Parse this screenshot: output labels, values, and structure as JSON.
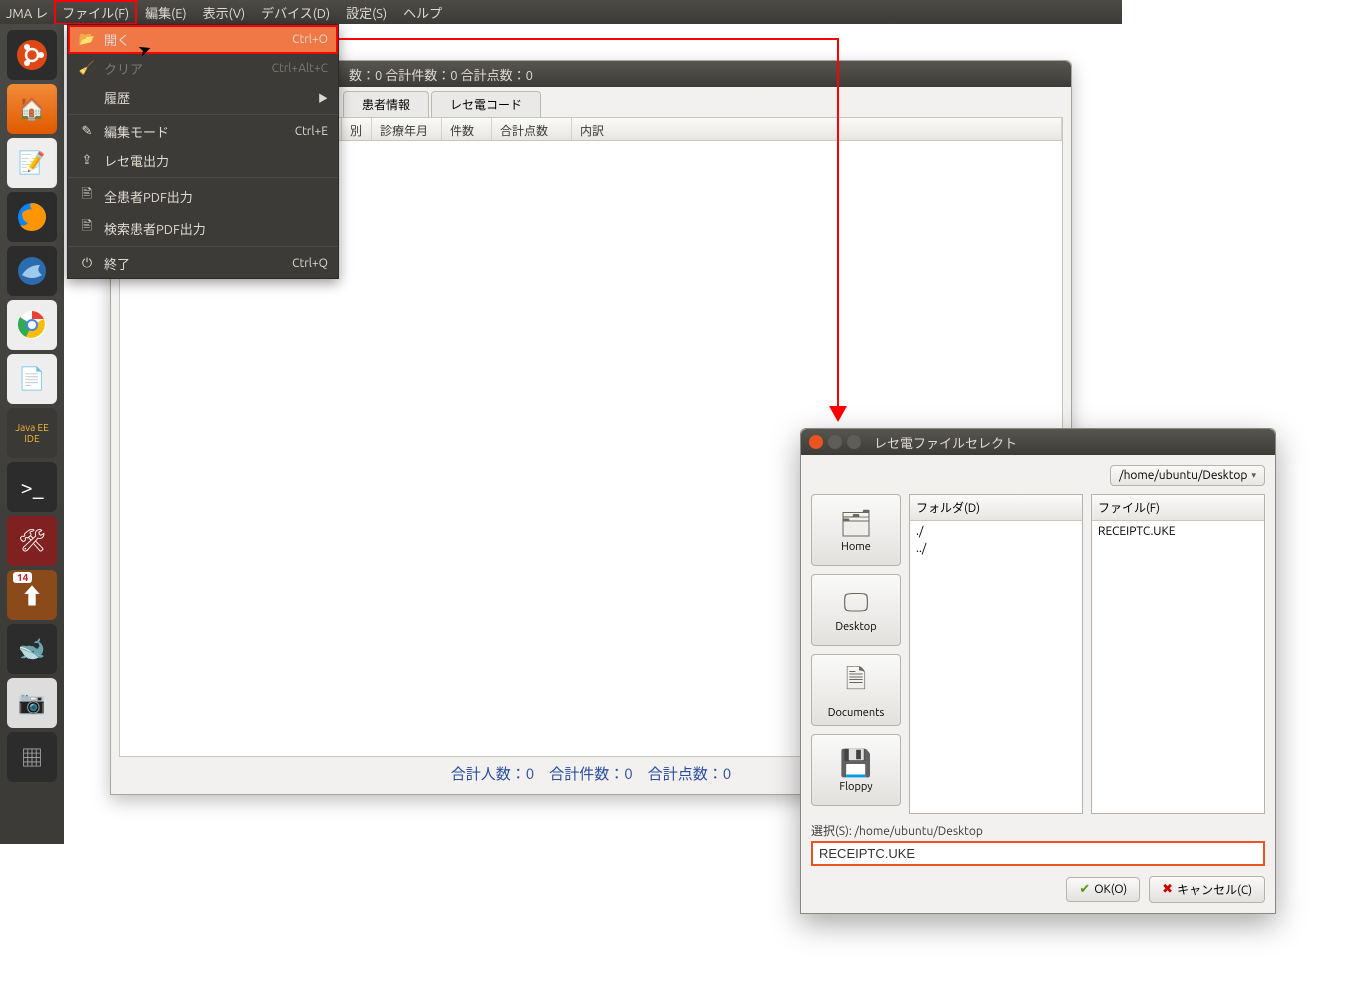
{
  "menubar": {
    "app_prefix": "JMA レ",
    "items": [
      "ファイル(F)",
      "編集(E)",
      "表示(V)",
      "デバイス(D)",
      "設定(S)",
      "ヘルプ"
    ]
  },
  "dropdown": {
    "open": {
      "label": "開く",
      "shortcut": "Ctrl+O"
    },
    "clear": {
      "label": "クリア",
      "shortcut": "Ctrl+Alt+C"
    },
    "history": {
      "label": "履歴"
    },
    "editmode": {
      "label": "編集モード",
      "shortcut": "Ctrl+E"
    },
    "receden": {
      "label": "レセ電出力"
    },
    "allpdf": {
      "label": "全患者PDF出力"
    },
    "searchpdf": {
      "label": "検索患者PDF出力"
    },
    "quit": {
      "label": "終了",
      "shortcut": "Ctrl+Q"
    }
  },
  "app": {
    "title_fragment": "数：0  合計件数：0  合計点数：0",
    "tabs": {
      "patient": "患者情報",
      "code": "レセ電コード"
    },
    "columns": {
      "c1": "別",
      "c2": "診療年月",
      "c3": "件数",
      "c4": "合計点数",
      "c5": "内訳"
    },
    "footer": "合計人数：0　合計件数：0　合計点数：0"
  },
  "dialog": {
    "title": "レセ電ファイルセレクト",
    "path": "/home/ubuntu/Desktop",
    "places": {
      "home": "Home",
      "desktop": "Desktop",
      "documents": "Documents",
      "floppy": "Floppy"
    },
    "folder_header": "フォルダ(D)",
    "file_header": "ファイル(F)",
    "folders": {
      "dot": "./",
      "dotdot": "../"
    },
    "files": {
      "f1": "RECEIPTC.UKE"
    },
    "selection_label": "選択(S): /home/ubuntu/Desktop",
    "selection_value": "RECEIPTC.UKE",
    "ok": "OK(O)",
    "cancel": "キャンセル(C)"
  },
  "launcher": {
    "badge": "14"
  }
}
